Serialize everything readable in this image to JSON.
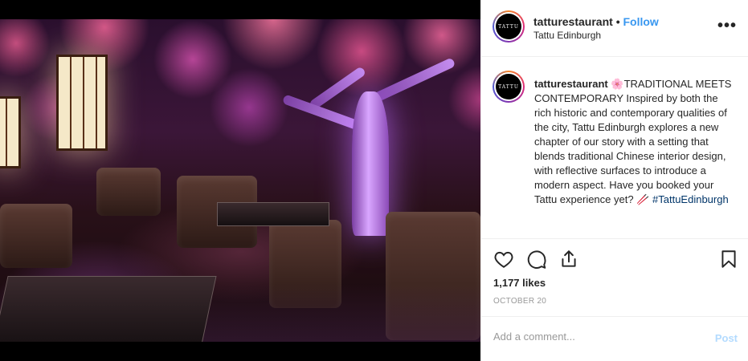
{
  "post": {
    "username": "tatturestaurant",
    "separator": "•",
    "follow_label": "Follow",
    "location": "Tattu Edinburgh",
    "more_label": "•••",
    "avatar_logo_text": "TATTU",
    "caption": {
      "username": "tatturestaurant",
      "emoji": "🌸",
      "heading": "TRADITIONAL MEETS CONTEMPORARY",
      "body": "Inspired by both the rich historic and contemporary qualities of the city, Tattu Edinburgh explores a new chapter of our story with a setting that blends traditional Chinese interior design, with reflective surfaces to introduce a modern aspect. Have you booked your Tattu experience yet?",
      "chopsticks": "🥢",
      "hashtag": "#TattuEdinburgh"
    },
    "likes": "1,177 likes",
    "date": "OCTOBER 20",
    "comment_placeholder": "Add a comment...",
    "post_label": "Post"
  },
  "icons": {
    "like": "heart-icon",
    "comment": "comment-icon",
    "share": "share-icon",
    "save": "bookmark-icon",
    "more": "more-options-icon"
  },
  "colors": {
    "link": "#3897f0",
    "hashtag": "#003569",
    "post_disabled": "#b3dbff",
    "muted": "#999999"
  }
}
